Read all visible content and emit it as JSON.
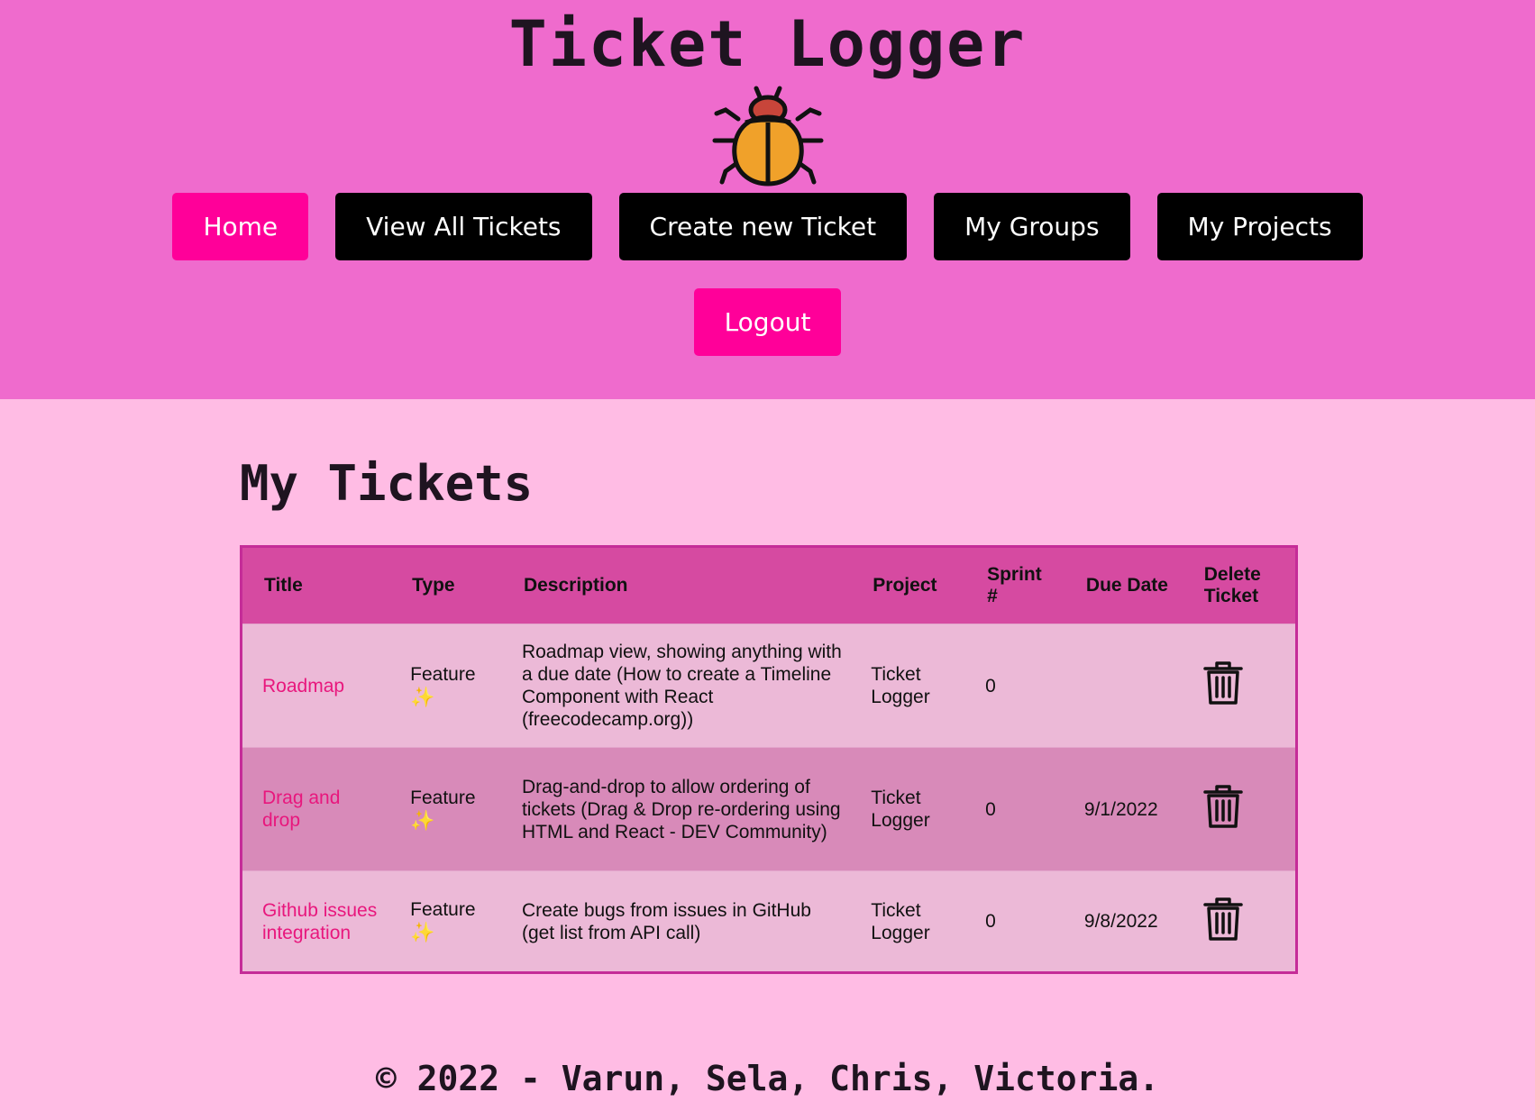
{
  "header": {
    "title": "Ticket Logger",
    "logo_icon": "ladybug-icon",
    "nav": [
      {
        "label": "Home",
        "active": true
      },
      {
        "label": "View All Tickets",
        "active": false
      },
      {
        "label": "Create new Ticket",
        "active": false
      },
      {
        "label": "My Groups",
        "active": false
      },
      {
        "label": "My Projects",
        "active": false
      }
    ],
    "logout_label": "Logout"
  },
  "main": {
    "section_title": "My Tickets",
    "table": {
      "columns": [
        "Title",
        "Type",
        "Description",
        "Project",
        "Sprint #",
        "Due Date",
        "Delete Ticket"
      ],
      "rows": [
        {
          "title": "Roadmap",
          "type": "Feature",
          "type_icon": "sparkles-icon",
          "description": "Roadmap view, showing anything with a due date (How to create a Timeline Component with React (freecodecamp.org))",
          "project": "Ticket Logger",
          "sprint": "0",
          "due_date": "",
          "delete_icon": "trash-icon"
        },
        {
          "title": "Drag and drop",
          "type": "Feature",
          "type_icon": "sparkles-icon",
          "description": "Drag-and-drop to allow ordering of tickets (Drag & Drop re-ordering using HTML and React - DEV Community)",
          "project": "Ticket Logger",
          "sprint": "0",
          "due_date": "9/1/2022",
          "delete_icon": "trash-icon"
        },
        {
          "title": "Github issues integration",
          "type": "Feature",
          "type_icon": "sparkles-icon",
          "description": "Create bugs from issues in GitHub (get list from API call)",
          "project": "Ticket Logger",
          "sprint": "0",
          "due_date": "9/8/2022",
          "delete_icon": "trash-icon"
        }
      ]
    }
  },
  "footer": {
    "text": "© 2022 - Varun, Sela, Chris, Victoria."
  },
  "colors": {
    "header_bg": "#ef6bcd",
    "page_bg": "#ffbce4",
    "accent_button": "#ff0099",
    "table_header_bg": "#d64aa1",
    "link": "#e8177d"
  }
}
